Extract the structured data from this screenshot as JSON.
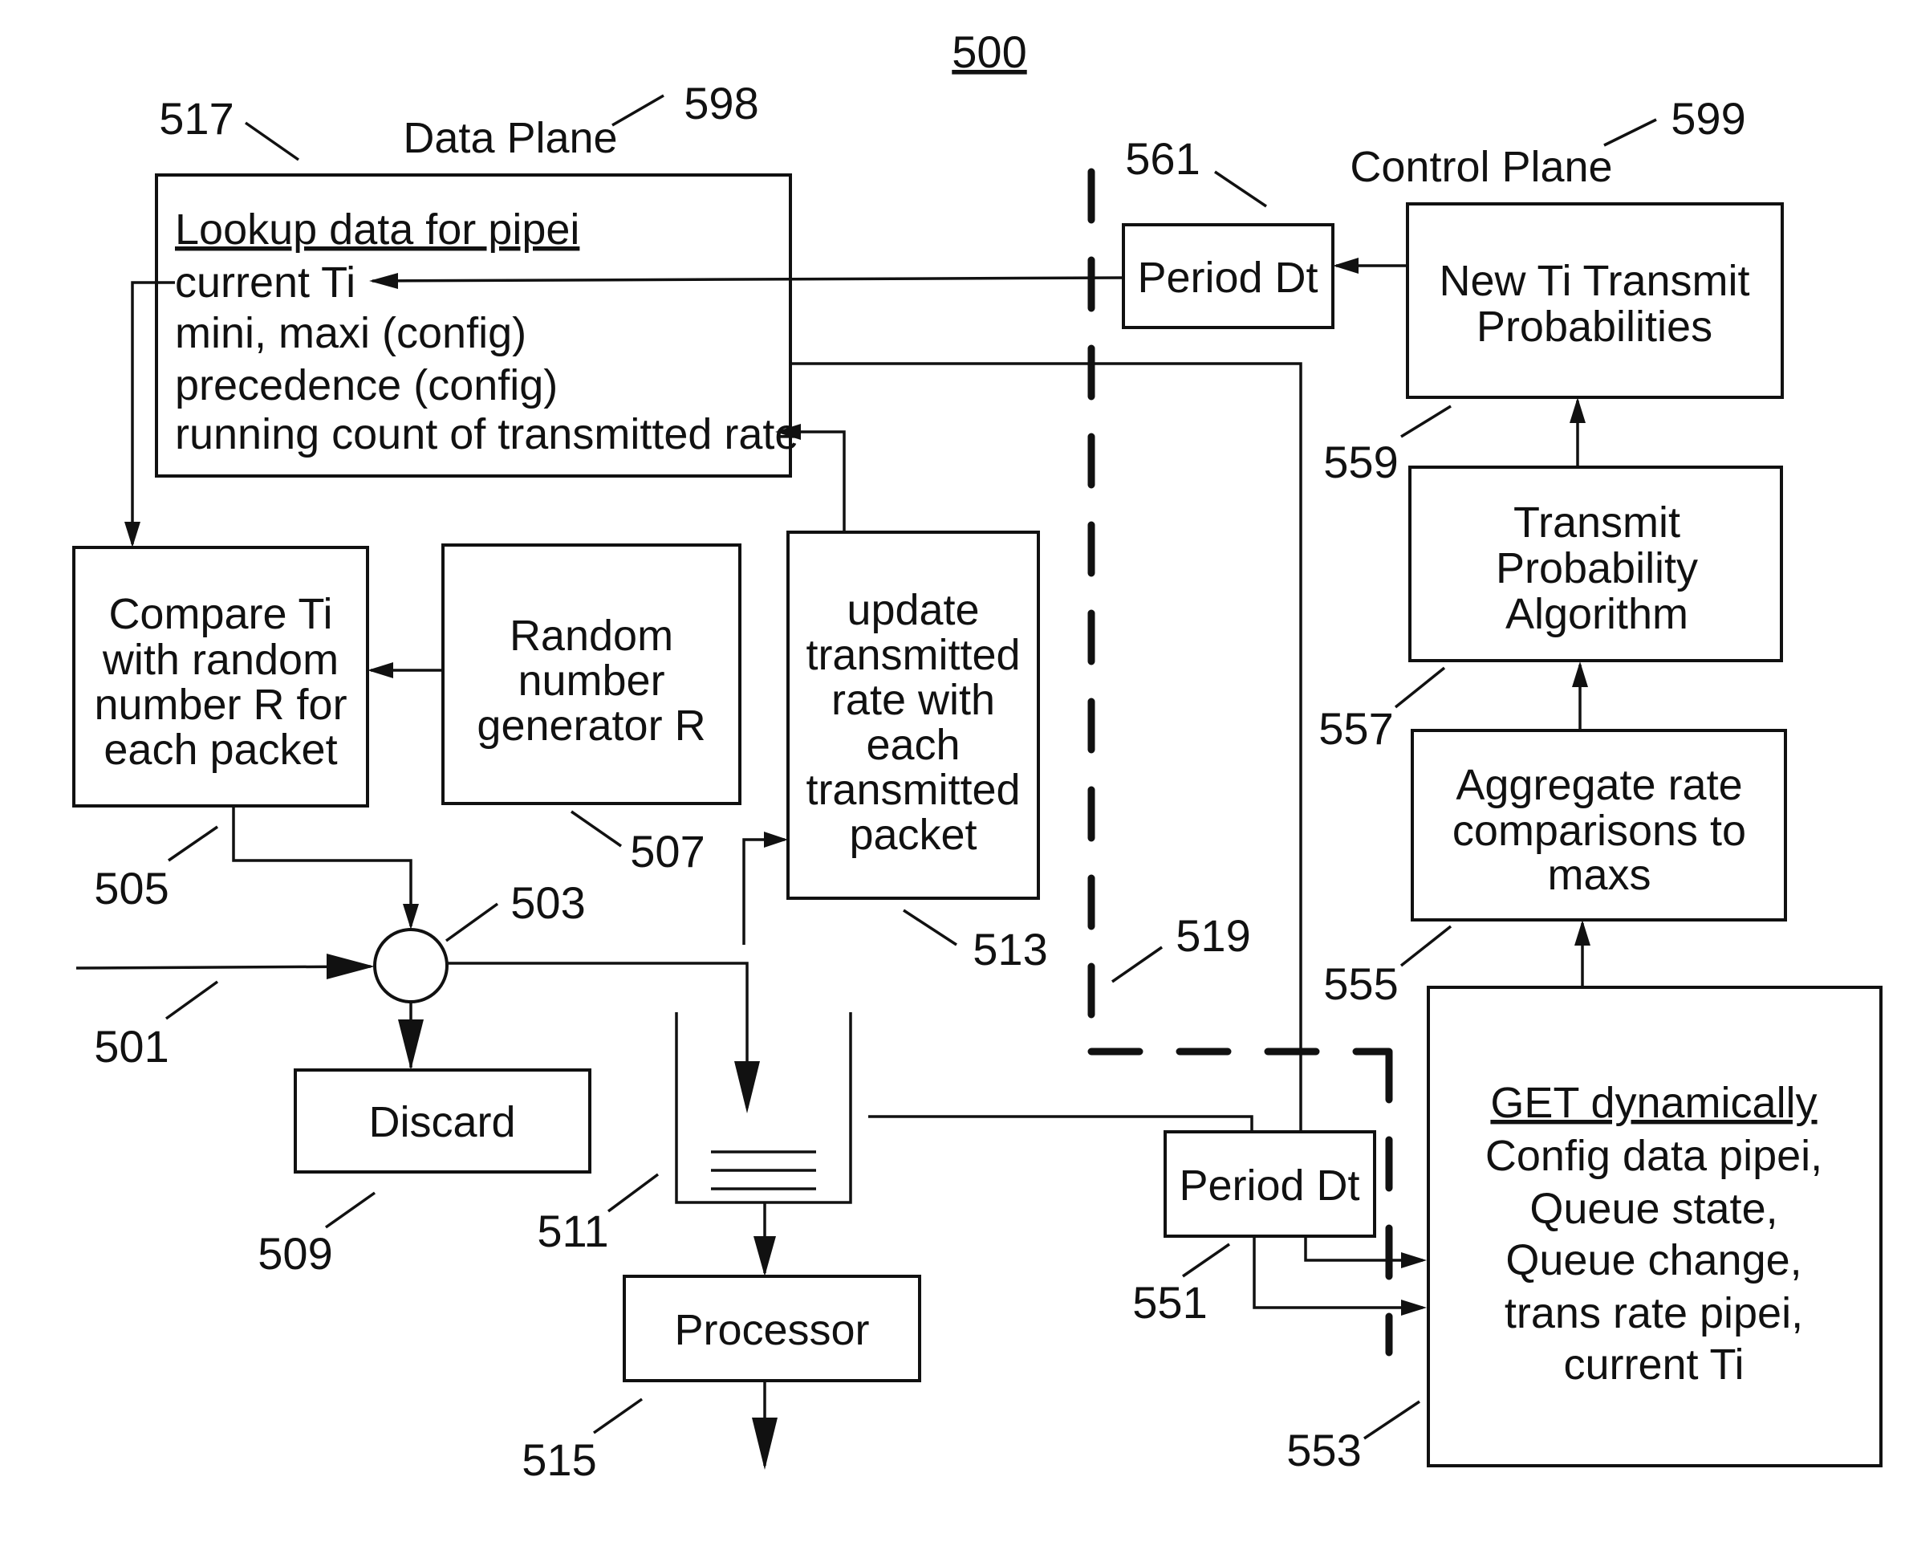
{
  "figure": {
    "number": "500",
    "data_plane": {
      "label": "Data Plane",
      "ref": "598"
    },
    "control_plane": {
      "label": "Control Plane",
      "ref": "599"
    }
  },
  "lookup": {
    "ref": "517",
    "title": "Lookup data for pipei",
    "lines": [
      "current Ti",
      "mini, maxi (config)",
      "precedence (config)",
      "running count of transmitted rate"
    ]
  },
  "compare": {
    "ref": "505",
    "lines": [
      "Compare Ti",
      "with random",
      "number R for",
      "each packet"
    ]
  },
  "random": {
    "ref": "507",
    "lines": [
      "Random",
      "number",
      "generator R"
    ]
  },
  "update": {
    "ref": "513",
    "lines": [
      "update",
      "transmitted",
      "rate with",
      "each",
      "transmitted",
      "packet"
    ]
  },
  "junction": {
    "ref": "503"
  },
  "input": {
    "ref": "501"
  },
  "discard": {
    "ref": "509",
    "label": "Discard"
  },
  "queue": {
    "ref": "511"
  },
  "processor": {
    "ref": "515",
    "label": "Processor"
  },
  "boundary": {
    "ref": "519"
  },
  "period_top": {
    "ref": "561",
    "label": "Period Dt"
  },
  "period_bottom": {
    "ref": "551",
    "label": "Period Dt"
  },
  "new_ti": {
    "ref": "559",
    "lines": [
      "New Ti Transmit",
      "Probabilities"
    ]
  },
  "algorithm": {
    "ref": "557",
    "lines": [
      "Transmit",
      "Probability",
      "Algorithm"
    ]
  },
  "aggregate": {
    "ref": "555",
    "lines": [
      "Aggregate rate",
      "comparisons to",
      "maxs"
    ]
  },
  "get": {
    "ref": "553",
    "title": "GET dynamically",
    "lines": [
      "Config data pipei,",
      "Queue state,",
      "Queue change,",
      "trans rate pipei,",
      "current Ti"
    ]
  }
}
